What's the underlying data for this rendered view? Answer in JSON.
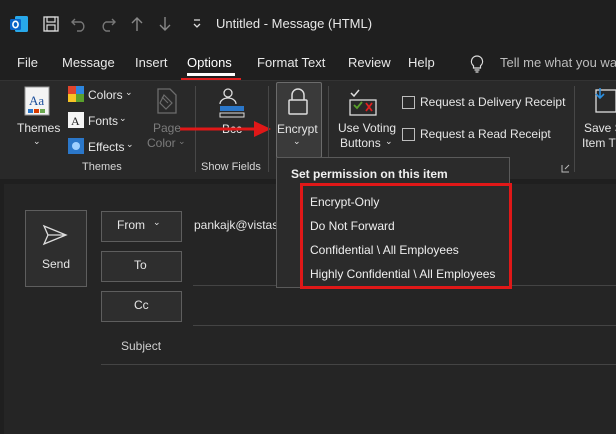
{
  "titlebar": {
    "title": "Untitled  -  Message (HTML)",
    "icons": [
      "outlook-logo",
      "save-icon",
      "undo-icon",
      "redo-icon",
      "up-arrow-icon",
      "down-arrow-icon",
      "customize-toolbar-icon"
    ]
  },
  "tabs": [
    {
      "label": "File"
    },
    {
      "label": "Message"
    },
    {
      "label": "Insert"
    },
    {
      "label": "Options"
    },
    {
      "label": "Format Text"
    },
    {
      "label": "Review"
    },
    {
      "label": "Help"
    }
  ],
  "active_tab": "Options",
  "tellme": {
    "label": "Tell me what you wa"
  },
  "ribbon": {
    "themes_label": "Themes",
    "colors_label": "Colors",
    "fonts_label": "Fonts",
    "effects_label": "Effects",
    "page_color_line1": "Page",
    "page_color_line2": "Color",
    "themes_group": "Themes",
    "bcc_label": "Bcc",
    "show_fields_group": "Show Fields",
    "encrypt_label": "Encrypt",
    "voting_line1": "Use Voting",
    "voting_line2": "Buttons",
    "delivery_receipt": "Request a Delivery Receipt",
    "read_receipt": "Request a Read Receipt",
    "save_line1": "Save S",
    "save_line2": "Item T"
  },
  "encrypt_menu": {
    "header": "Set permission on this item",
    "items": [
      {
        "label": "Encrypt-Only"
      },
      {
        "label": "Do Not Forward"
      },
      {
        "label": "Confidential \\ All Employees"
      },
      {
        "label": "Highly Confidential \\ All Employees"
      }
    ]
  },
  "compose": {
    "send_label": "Send",
    "from_label": "From",
    "from_value": "pankajk@vistas",
    "to_label": "To",
    "cc_label": "Cc",
    "subject_label": "Subject"
  },
  "colors": {
    "accent_red": "#e01818",
    "background": "#1f1f1f",
    "ribbon": "#292929"
  }
}
